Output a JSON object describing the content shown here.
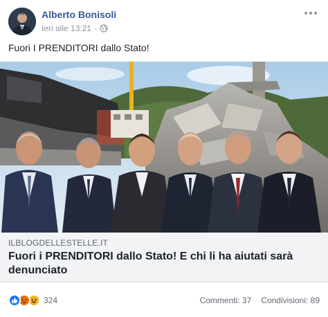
{
  "post": {
    "author": "Alberto Bonisoli",
    "timestamp": "Ieri alle 13:21",
    "separator": "·",
    "privacy_icon": "globe-icon",
    "more_icon": "ellipsis-icon",
    "text": "Fuori I PRENDITORI dallo Stato!"
  },
  "link": {
    "domain": "ILBLOGDELLESTELLE.IT",
    "headline": "Fuori i PRENDITORI dallo Stato! E chi li ha aiutati sarà denunciato"
  },
  "footer": {
    "reaction_icons": [
      "like-icon",
      "angry-icon",
      "haha-icon"
    ],
    "reaction_count": "324",
    "comments": "Commenti: 37",
    "shares": "Condivisioni: 89"
  },
  "colors": {
    "author_link": "#385898",
    "like": "#1877f2",
    "angry": "#e9710f",
    "haha": "#f7b125"
  }
}
